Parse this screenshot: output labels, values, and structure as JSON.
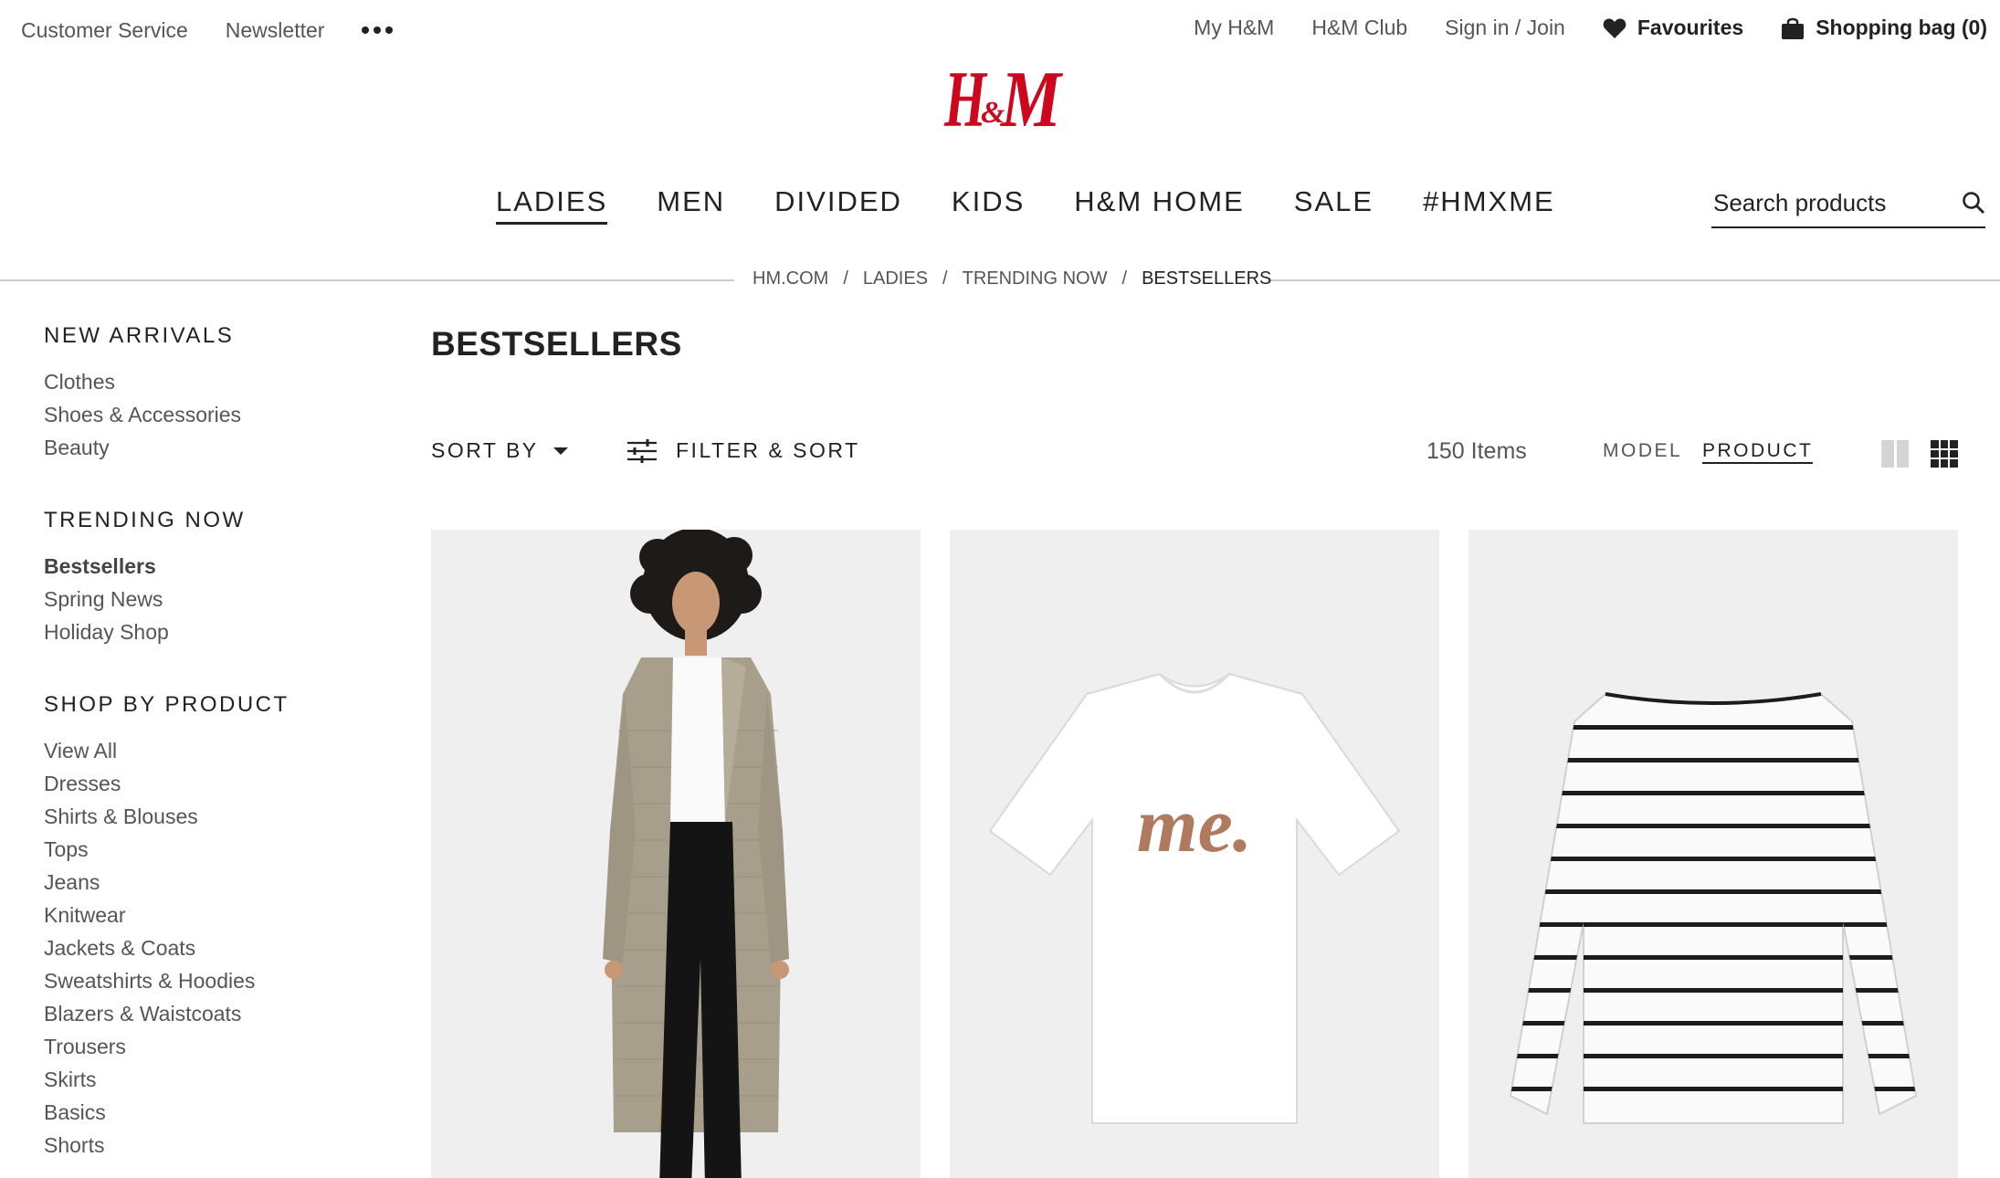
{
  "utility_left": {
    "customer_service": "Customer Service",
    "newsletter": "Newsletter"
  },
  "utility_right": {
    "my_hm": "My H&M",
    "hm_club": "H&M Club",
    "sign_in": "Sign in / Join",
    "favourites": "Favourites",
    "shopping_bag": "Shopping bag (0)"
  },
  "logo": {
    "text": "H&M",
    "color": "#cc071e"
  },
  "nav": {
    "items": [
      {
        "label": "LADIES",
        "active": true
      },
      {
        "label": "MEN"
      },
      {
        "label": "DIVIDED"
      },
      {
        "label": "KIDS"
      },
      {
        "label": "H&M HOME"
      },
      {
        "label": "SALE"
      },
      {
        "label": "#HMXME"
      }
    ]
  },
  "search": {
    "placeholder": "Search products"
  },
  "breadcrumb": [
    "HM.COM",
    "LADIES",
    "TRENDING NOW",
    "BESTSELLERS"
  ],
  "sidebar": {
    "sections": [
      {
        "heading": "NEW ARRIVALS",
        "items": [
          "Clothes",
          "Shoes & Accessories",
          "Beauty"
        ]
      },
      {
        "heading": "TRENDING NOW",
        "items": [
          "Bestsellers",
          "Spring News",
          "Holiday Shop"
        ],
        "active_item": "Bestsellers"
      },
      {
        "heading": "SHOP BY PRODUCT",
        "items": [
          "View All",
          "Dresses",
          "Shirts & Blouses",
          "Tops",
          "Jeans",
          "Knitwear",
          "Jackets & Coats",
          "Sweatshirts & Hoodies",
          "Blazers & Waistcoats",
          "Trousers",
          "Skirts",
          "Basics",
          "Shorts"
        ]
      }
    ]
  },
  "page_title": "BESTSELLERS",
  "toolbar": {
    "sort_label": "SORT BY",
    "filter_label": "FILTER & SORT",
    "item_count": "150 Items",
    "view_model": "MODEL",
    "view_product": "PRODUCT",
    "active_view": "PRODUCT"
  },
  "products": [
    {
      "name": "Trench coat (model)",
      "icon": "model-photo"
    },
    {
      "name": "T-shirt",
      "print_text": "me.",
      "icon": "tshirt-photo"
    },
    {
      "name": "Striped top",
      "icon": "striped-top-photo"
    }
  ],
  "colors": {
    "brand_red": "#cc071e",
    "text": "#222222",
    "muted": "#555555",
    "image_bg": "#efefef"
  }
}
